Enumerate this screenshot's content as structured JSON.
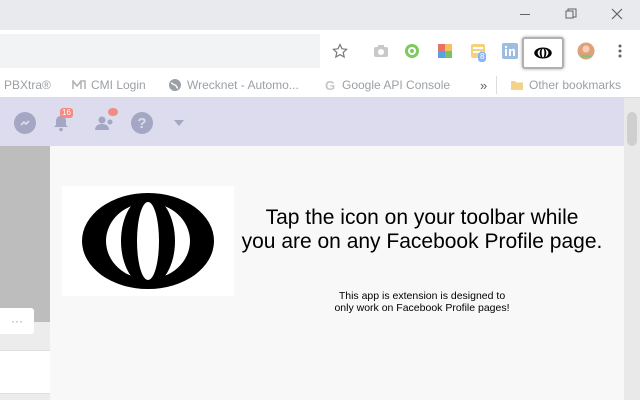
{
  "bookmarks": {
    "items": [
      {
        "label": "PBXtra®"
      },
      {
        "label": "CMI Login"
      },
      {
        "label": "Wrecknet - Automo..."
      },
      {
        "label": "Google API Console"
      }
    ],
    "overflow": "»",
    "other": "Other bookmarks"
  },
  "toolbar": {
    "extension_badge": "8"
  },
  "facebook": {
    "notifications_count": "16"
  },
  "popup": {
    "headline_line1": "Tap the icon on your toolbar while",
    "headline_line2": "you are on any Facebook Profile page.",
    "note_line1": "This app is extension is designed to",
    "note_line2": "only work on Facebook Profile pages!"
  },
  "page": {
    "more_button": "···"
  },
  "icons": {
    "window": [
      "minimize-icon",
      "restore-icon",
      "close-icon"
    ],
    "toolbar": [
      "star-icon",
      "camera-icon",
      "green-circle-icon",
      "photo-icon",
      "extension-badge-icon",
      "linkedin-icon",
      "eye-logo-icon",
      "avatar-icon",
      "menu-icon"
    ],
    "facebook": [
      "messenger-icon",
      "notifications-icon",
      "friends-icon",
      "help-icon",
      "caret-down-icon"
    ]
  },
  "colors": {
    "fb_bar": "#dcdcee",
    "badge": "#f28b82",
    "logo": "#000000"
  }
}
